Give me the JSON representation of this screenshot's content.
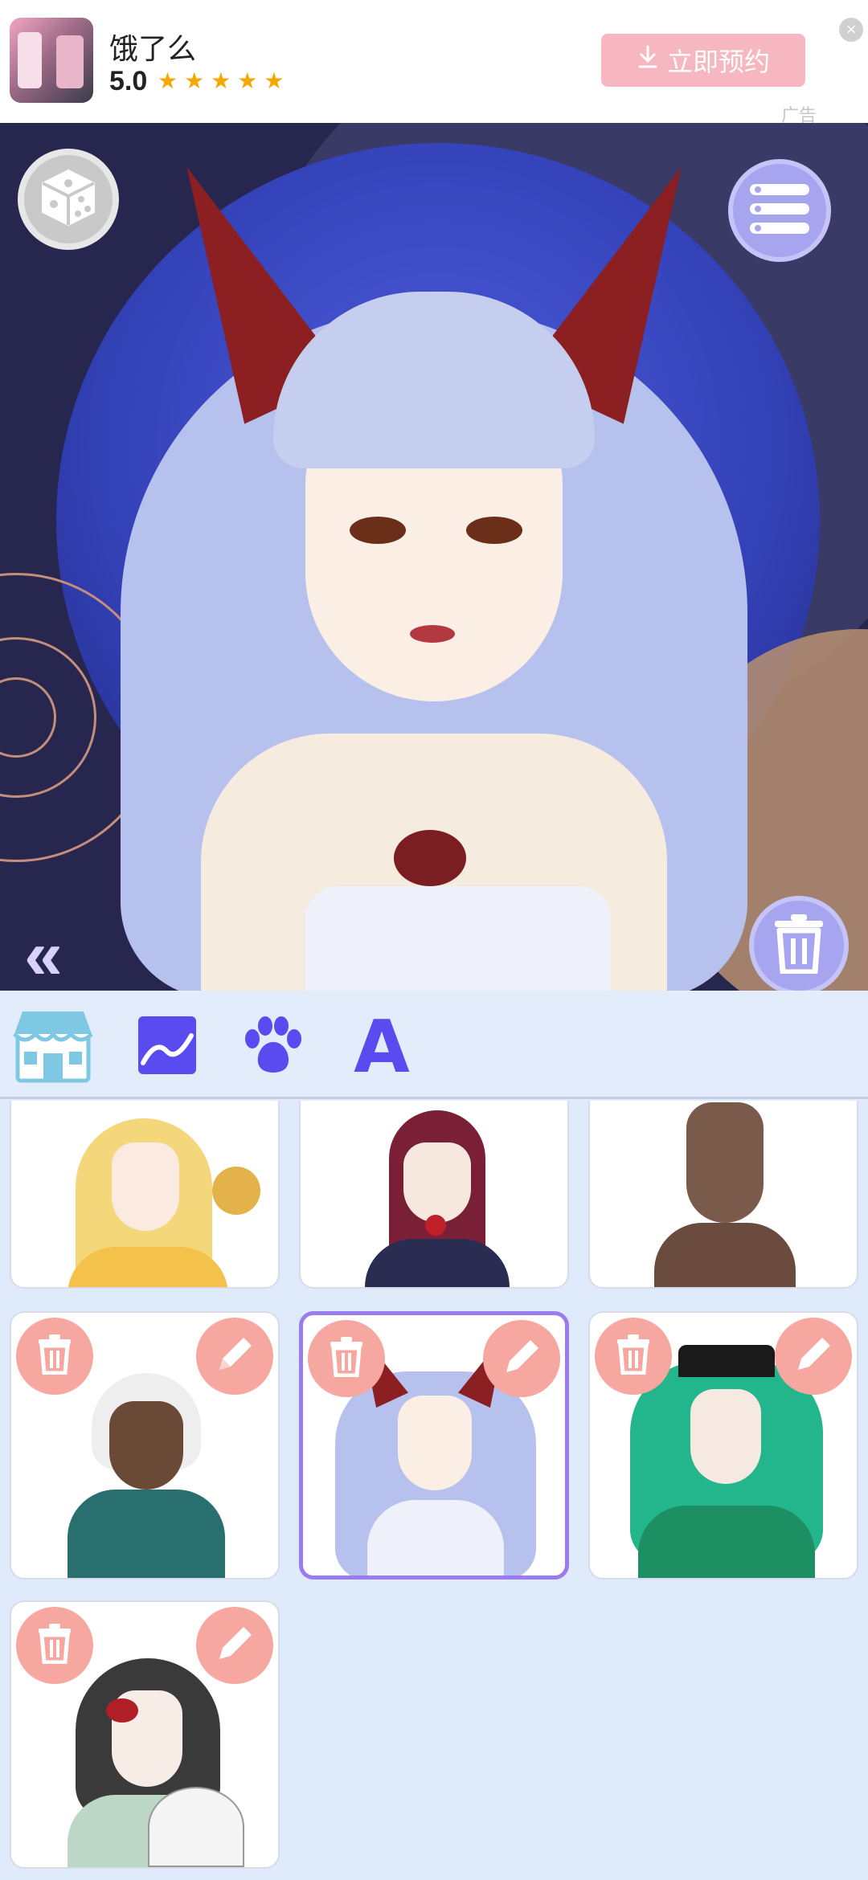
{
  "ad": {
    "app_name": "饿了么",
    "rating": "5.0",
    "stars": "★★★★★",
    "cta_label": "立即预约",
    "ad_label": "广告",
    "close_glyph": "×"
  },
  "preview": {
    "back_arrows": "«"
  },
  "tabs": [
    {
      "name": "shop",
      "icon": "shop-icon"
    },
    {
      "name": "scene",
      "icon": "scene-icon"
    },
    {
      "name": "pet",
      "icon": "paw-icon"
    },
    {
      "name": "text",
      "icon": "text-icon",
      "letter": "A"
    }
  ],
  "cards": [
    {
      "hair": "#f3d77a",
      "skin": "#fbeadf",
      "outfit": "#f4c24a",
      "has_actions": false
    },
    {
      "hair": "#7a2036",
      "skin": "#f7e8df",
      "outfit": "#2a2c52",
      "has_actions": false
    },
    {
      "hair": "#7a5a4a",
      "skin": "#7a5a4a",
      "outfit": "#6a4b3e",
      "has_actions": false
    },
    {
      "hair": "#eeeeee",
      "skin": "#6a4a36",
      "outfit": "#2a6f6f",
      "has_actions": true
    },
    {
      "hair": "#b7c1ee",
      "skin": "#fbeee5",
      "outfit": "#eef0fa",
      "has_actions": true,
      "selected": true
    },
    {
      "hair": "#23b58b",
      "skin": "#f6e9e2",
      "outfit": "#1e8f62",
      "has_actions": true
    },
    {
      "hair": "#3a3a3a",
      "skin": "#f7ece6",
      "outfit": "#bcd7c6",
      "has_actions": true
    }
  ],
  "colors": {
    "accent": "#a8a5f0",
    "action": "#f6a7a0",
    "selected_border": "#9a7cf0"
  }
}
